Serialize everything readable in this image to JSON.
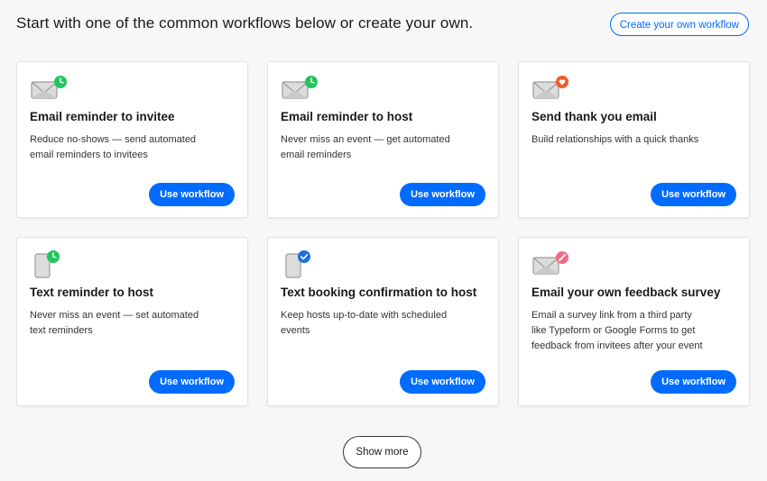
{
  "intro": "Start with one of the common workflows below or create your own.",
  "create_button": "Create your own workflow",
  "cards": [
    {
      "title": "Email reminder to invitee",
      "description": "Reduce no-shows — send automated email reminders to invitees",
      "button": "Use workflow",
      "icon": "envelope-clock-icon",
      "badge_color": "#22c55e"
    },
    {
      "title": "Email reminder to host",
      "description": "Never miss an event — get automated email reminders",
      "button": "Use workflow",
      "icon": "envelope-clock-icon",
      "badge_color": "#22c55e"
    },
    {
      "title": "Send thank you email",
      "description": "Build relationships with a quick thanks",
      "button": "Use workflow",
      "icon": "envelope-heart-icon",
      "badge_color": "#f05a28"
    },
    {
      "title": "Text reminder to host",
      "description": "Never miss an event — set automated text reminders",
      "button": "Use workflow",
      "icon": "phone-clock-icon",
      "badge_color": "#22c55e"
    },
    {
      "title": "Text booking confirmation to host",
      "description": "Keep hosts up-to-date with scheduled events",
      "button": "Use workflow",
      "icon": "phone-check-icon",
      "badge_color": "#1f6fe0"
    },
    {
      "title": "Email your own feedback survey",
      "description": "Email a survey link from a third party like Typeform or Google Forms to get feedback from invitees after your event",
      "button": "Use workflow",
      "icon": "envelope-pencil-icon",
      "badge_color": "#ef6b8a"
    }
  ],
  "show_more": "Show more",
  "accent_color": "#006bff"
}
